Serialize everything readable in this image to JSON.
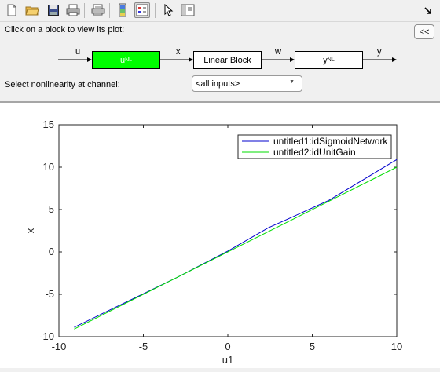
{
  "toolbar": {
    "items": [
      {
        "name": "new-file-icon"
      },
      {
        "name": "open-folder-icon"
      },
      {
        "name": "save-icon"
      },
      {
        "name": "print-icon"
      },
      {
        "name": "print-preview-icon"
      },
      {
        "name": "colorbar-icon"
      },
      {
        "name": "legend-icon"
      },
      {
        "name": "pointer-icon"
      },
      {
        "name": "plot-tools-icon"
      },
      {
        "name": "dock-icon"
      }
    ]
  },
  "header": {
    "instruction": "Click on a block to view its plot:",
    "collapse_label": "<<"
  },
  "diagram": {
    "selected_color": "#00ff00",
    "blocks": [
      {
        "label": "u",
        "sub": "NL"
      },
      {
        "label": "Linear Block"
      },
      {
        "label": "y",
        "sub": "NL"
      }
    ],
    "signals": [
      "u",
      "x",
      "w",
      "y"
    ]
  },
  "channel": {
    "label": "Select nonlinearity at channel:",
    "value": "<all inputs>"
  },
  "chart_data": {
    "type": "line",
    "xlabel": "u1",
    "ylabel": "x",
    "xlim": [
      -10,
      10
    ],
    "ylim": [
      -10,
      15
    ],
    "xticks": [
      "-10",
      "-5",
      "0",
      "5",
      "10"
    ],
    "yticks": [
      "-10",
      "-5",
      "0",
      "5",
      "10",
      "15"
    ],
    "grid": false,
    "legend_position": "top-right",
    "series": [
      {
        "name": "untitled1:idSigmoidNetwork",
        "color": "#0000cc",
        "x": [
          -9.1,
          -6,
          -3,
          0,
          2.4,
          3.8,
          6,
          10
        ],
        "y": [
          -8.9,
          -5.9,
          -3.0,
          0.1,
          2.85,
          4.1,
          6.1,
          10.9
        ]
      },
      {
        "name": "untitled2:idUnitGain",
        "color": "#00dd00",
        "x": [
          -9.1,
          10
        ],
        "y": [
          -9.1,
          10
        ]
      }
    ]
  }
}
